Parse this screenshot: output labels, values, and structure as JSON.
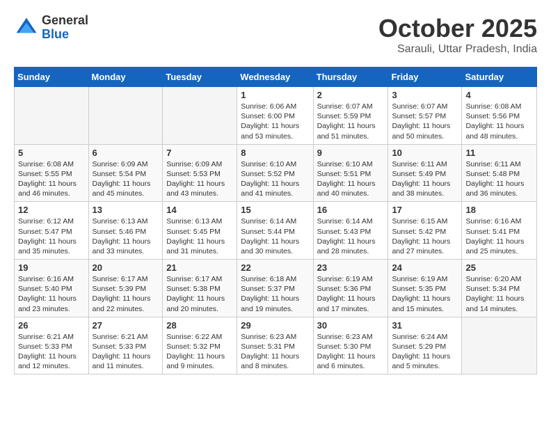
{
  "header": {
    "logo_general": "General",
    "logo_blue": "Blue",
    "month": "October 2025",
    "location": "Sarauli, Uttar Pradesh, India"
  },
  "days_of_week": [
    "Sunday",
    "Monday",
    "Tuesday",
    "Wednesday",
    "Thursday",
    "Friday",
    "Saturday"
  ],
  "weeks": [
    [
      {
        "day": "",
        "info": ""
      },
      {
        "day": "",
        "info": ""
      },
      {
        "day": "",
        "info": ""
      },
      {
        "day": "1",
        "info": "Sunrise: 6:06 AM\nSunset: 6:00 PM\nDaylight: 11 hours\nand 53 minutes."
      },
      {
        "day": "2",
        "info": "Sunrise: 6:07 AM\nSunset: 5:59 PM\nDaylight: 11 hours\nand 51 minutes."
      },
      {
        "day": "3",
        "info": "Sunrise: 6:07 AM\nSunset: 5:57 PM\nDaylight: 11 hours\nand 50 minutes."
      },
      {
        "day": "4",
        "info": "Sunrise: 6:08 AM\nSunset: 5:56 PM\nDaylight: 11 hours\nand 48 minutes."
      }
    ],
    [
      {
        "day": "5",
        "info": "Sunrise: 6:08 AM\nSunset: 5:55 PM\nDaylight: 11 hours\nand 46 minutes."
      },
      {
        "day": "6",
        "info": "Sunrise: 6:09 AM\nSunset: 5:54 PM\nDaylight: 11 hours\nand 45 minutes."
      },
      {
        "day": "7",
        "info": "Sunrise: 6:09 AM\nSunset: 5:53 PM\nDaylight: 11 hours\nand 43 minutes."
      },
      {
        "day": "8",
        "info": "Sunrise: 6:10 AM\nSunset: 5:52 PM\nDaylight: 11 hours\nand 41 minutes."
      },
      {
        "day": "9",
        "info": "Sunrise: 6:10 AM\nSunset: 5:51 PM\nDaylight: 11 hours\nand 40 minutes."
      },
      {
        "day": "10",
        "info": "Sunrise: 6:11 AM\nSunset: 5:49 PM\nDaylight: 11 hours\nand 38 minutes."
      },
      {
        "day": "11",
        "info": "Sunrise: 6:11 AM\nSunset: 5:48 PM\nDaylight: 11 hours\nand 36 minutes."
      }
    ],
    [
      {
        "day": "12",
        "info": "Sunrise: 6:12 AM\nSunset: 5:47 PM\nDaylight: 11 hours\nand 35 minutes."
      },
      {
        "day": "13",
        "info": "Sunrise: 6:13 AM\nSunset: 5:46 PM\nDaylight: 11 hours\nand 33 minutes."
      },
      {
        "day": "14",
        "info": "Sunrise: 6:13 AM\nSunset: 5:45 PM\nDaylight: 11 hours\nand 31 minutes."
      },
      {
        "day": "15",
        "info": "Sunrise: 6:14 AM\nSunset: 5:44 PM\nDaylight: 11 hours\nand 30 minutes."
      },
      {
        "day": "16",
        "info": "Sunrise: 6:14 AM\nSunset: 5:43 PM\nDaylight: 11 hours\nand 28 minutes."
      },
      {
        "day": "17",
        "info": "Sunrise: 6:15 AM\nSunset: 5:42 PM\nDaylight: 11 hours\nand 27 minutes."
      },
      {
        "day": "18",
        "info": "Sunrise: 6:16 AM\nSunset: 5:41 PM\nDaylight: 11 hours\nand 25 minutes."
      }
    ],
    [
      {
        "day": "19",
        "info": "Sunrise: 6:16 AM\nSunset: 5:40 PM\nDaylight: 11 hours\nand 23 minutes."
      },
      {
        "day": "20",
        "info": "Sunrise: 6:17 AM\nSunset: 5:39 PM\nDaylight: 11 hours\nand 22 minutes."
      },
      {
        "day": "21",
        "info": "Sunrise: 6:17 AM\nSunset: 5:38 PM\nDaylight: 11 hours\nand 20 minutes."
      },
      {
        "day": "22",
        "info": "Sunrise: 6:18 AM\nSunset: 5:37 PM\nDaylight: 11 hours\nand 19 minutes."
      },
      {
        "day": "23",
        "info": "Sunrise: 6:19 AM\nSunset: 5:36 PM\nDaylight: 11 hours\nand 17 minutes."
      },
      {
        "day": "24",
        "info": "Sunrise: 6:19 AM\nSunset: 5:35 PM\nDaylight: 11 hours\nand 15 minutes."
      },
      {
        "day": "25",
        "info": "Sunrise: 6:20 AM\nSunset: 5:34 PM\nDaylight: 11 hours\nand 14 minutes."
      }
    ],
    [
      {
        "day": "26",
        "info": "Sunrise: 6:21 AM\nSunset: 5:33 PM\nDaylight: 11 hours\nand 12 minutes."
      },
      {
        "day": "27",
        "info": "Sunrise: 6:21 AM\nSunset: 5:33 PM\nDaylight: 11 hours\nand 11 minutes."
      },
      {
        "day": "28",
        "info": "Sunrise: 6:22 AM\nSunset: 5:32 PM\nDaylight: 11 hours\nand 9 minutes."
      },
      {
        "day": "29",
        "info": "Sunrise: 6:23 AM\nSunset: 5:31 PM\nDaylight: 11 hours\nand 8 minutes."
      },
      {
        "day": "30",
        "info": "Sunrise: 6:23 AM\nSunset: 5:30 PM\nDaylight: 11 hours\nand 6 minutes."
      },
      {
        "day": "31",
        "info": "Sunrise: 6:24 AM\nSunset: 5:29 PM\nDaylight: 11 hours\nand 5 minutes."
      },
      {
        "day": "",
        "info": ""
      }
    ]
  ]
}
